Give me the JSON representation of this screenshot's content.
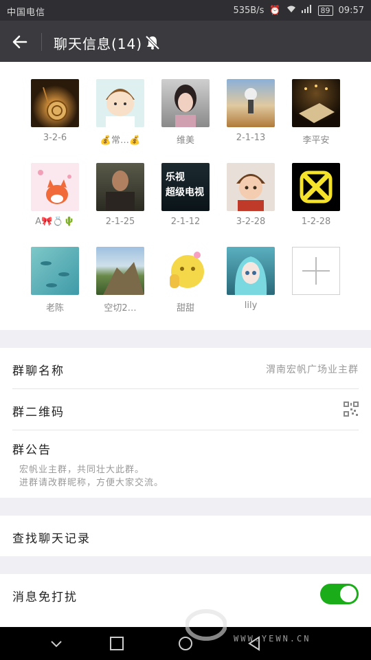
{
  "status_bar": {
    "carrier": "中国电信",
    "speed": "535B/s",
    "battery": "89",
    "time": "09:57"
  },
  "title_bar": {
    "title": "聊天信息(14)"
  },
  "members": [
    {
      "name": "3-2-6"
    },
    {
      "name": "💰常…💰"
    },
    {
      "name": "维美"
    },
    {
      "name": "2-1-13"
    },
    {
      "name": "李平安"
    },
    {
      "name": "A🎀💍🌵"
    },
    {
      "name": "2-1-25"
    },
    {
      "name": "2-1-12",
      "badge_line1": "乐视",
      "badge_line2": "超级电视"
    },
    {
      "name": "3-2-28"
    },
    {
      "name": "1-2-28"
    },
    {
      "name": "老陈"
    },
    {
      "name": "空切2…"
    },
    {
      "name": "甜甜"
    },
    {
      "name": "lily"
    }
  ],
  "settings": {
    "group_name_label": "群聊名称",
    "group_name_value": "渭南宏帆广场业主群",
    "qr_label": "群二维码",
    "notice_label": "群公告",
    "notice_line1": "宏帆业主群，共同壮大此群。",
    "notice_line2": "进群请改群昵称，方便大家交流。",
    "search_label": "查找聊天记录",
    "dnd_label": "消息免打扰",
    "dnd_enabled": true
  },
  "watermark": {
    "text": "WWW.YEWN.CN"
  },
  "colors": {
    "toggle_on": "#1aad19",
    "title_bar": "#3a3a3f"
  }
}
